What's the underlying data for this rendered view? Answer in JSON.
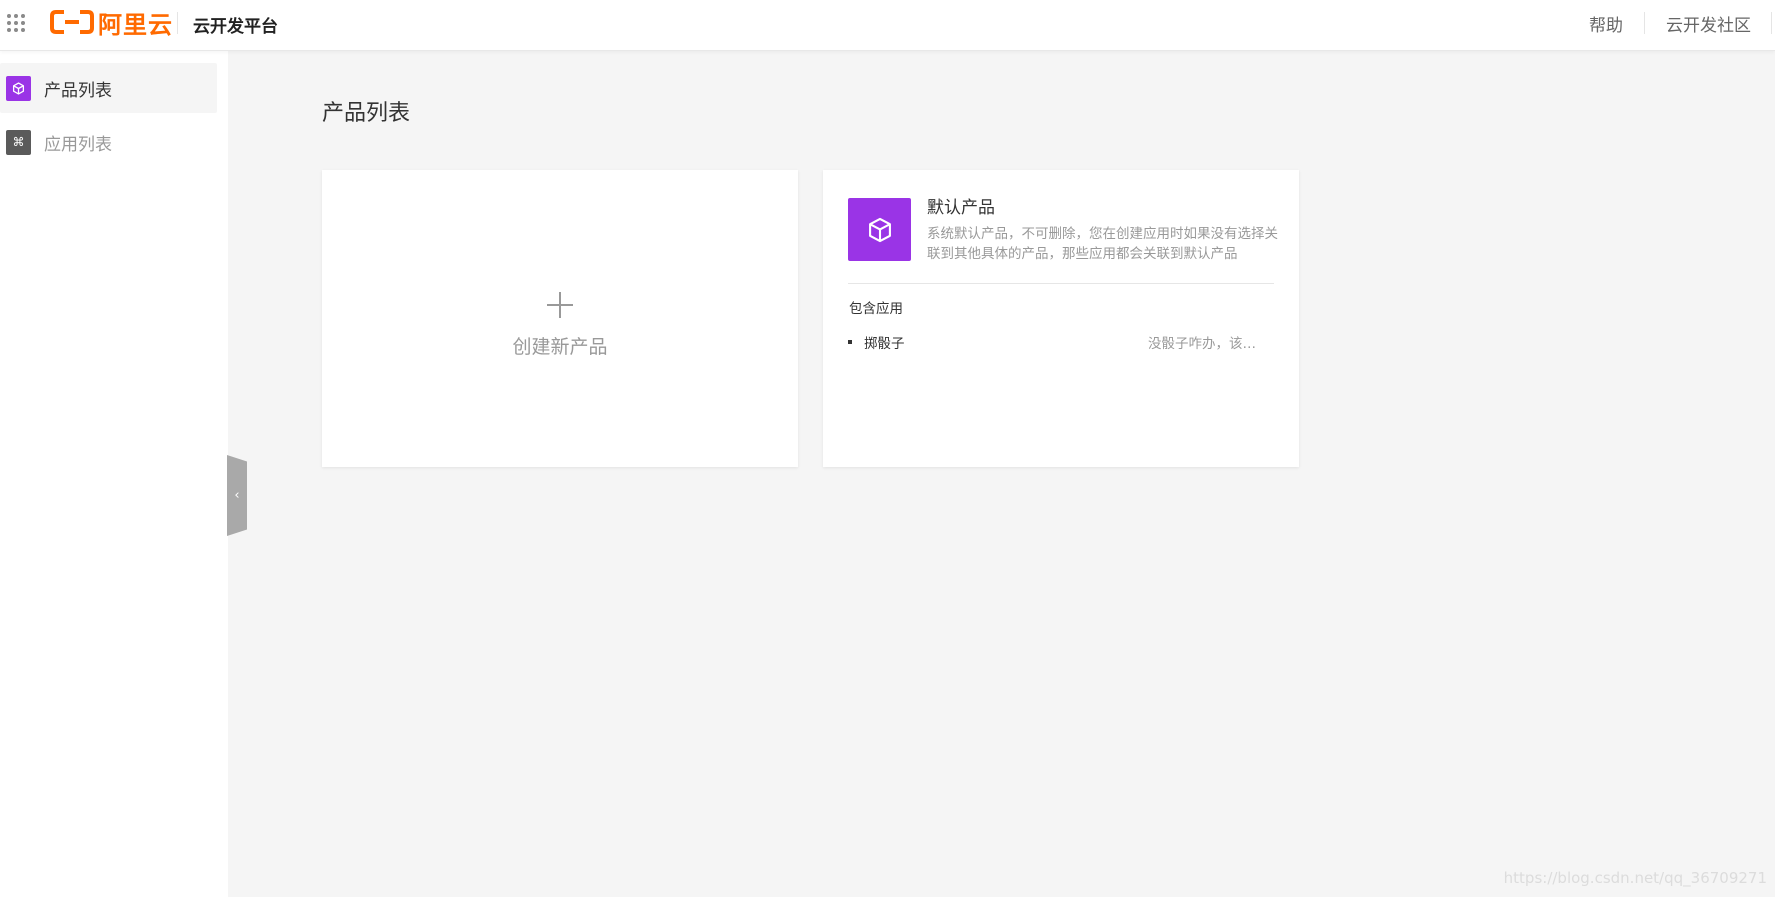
{
  "header": {
    "logo_text": "阿里云",
    "platform_title": "云开发平台",
    "links": [
      "帮助",
      "云开发社区"
    ]
  },
  "colors": {
    "brand_orange": "#ff6a00",
    "product_purple": "#9a34e6",
    "app_icon_gray": "#5a5a5a",
    "background": "#f5f5f5"
  },
  "sidebar": {
    "items": [
      {
        "label": "产品列表",
        "icon": "cube-icon",
        "active": true
      },
      {
        "label": "应用列表",
        "icon": "command-icon",
        "active": false
      }
    ]
  },
  "main": {
    "page_title": "产品列表",
    "create_card": {
      "label": "创建新产品"
    },
    "product_card": {
      "name": "默认产品",
      "description": "系统默认产品，不可删除，您在创建应用时如果没有选择关联到其他具体的产品，那些应用都会关联到默认产品",
      "apps_heading": "包含应用",
      "apps": [
        {
          "name": "掷骰子",
          "description": "没骰子咋办，该用骰子的时候"
        }
      ]
    }
  },
  "watermark": "https://blog.csdn.net/qq_36709271"
}
